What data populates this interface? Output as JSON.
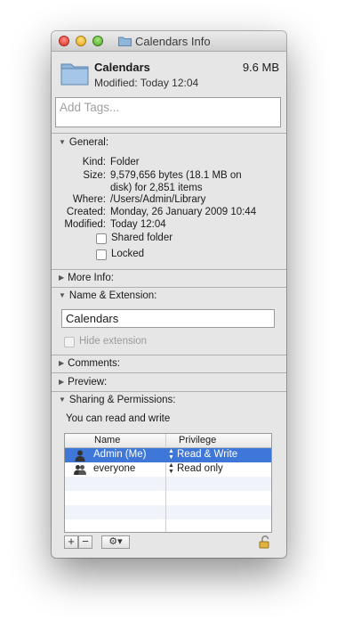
{
  "window": {
    "title": "Calendars Info"
  },
  "header": {
    "name": "Calendars",
    "size": "9.6 MB",
    "modified": "Modified: Today 12:04"
  },
  "tags": {
    "placeholder": "Add Tags..."
  },
  "general": {
    "heading": "General:",
    "kind_label": "Kind:",
    "kind": "Folder",
    "size_label": "Size:",
    "size_line1": "9,579,656 bytes (18.1 MB on",
    "size_line2": "disk) for 2,851 items",
    "where_label": "Where:",
    "where": "/Users/Admin/Library",
    "created_label": "Created:",
    "created": "Monday, 26 January 2009 10:44",
    "modified_label": "Modified:",
    "modified": "Today 12:04",
    "shared_folder": "Shared folder",
    "locked": "Locked"
  },
  "more_info": {
    "heading": "More Info:"
  },
  "name_extension": {
    "heading": "Name & Extension:",
    "value": "Calendars",
    "hide_extension": "Hide extension"
  },
  "comments": {
    "heading": "Comments:"
  },
  "preview": {
    "heading": "Preview:"
  },
  "sharing": {
    "heading": "Sharing & Permissions:",
    "status": "You can read and write",
    "columns": {
      "name": "Name",
      "privilege": "Privilege"
    },
    "rows": [
      {
        "name": "Admin (Me)",
        "privilege": "Read & Write"
      },
      {
        "name": "everyone",
        "privilege": "Read only"
      }
    ]
  },
  "toolbar": {
    "add": "+",
    "remove": "−",
    "action": "⚙▾"
  },
  "colors": {
    "selection": "#3e77d7",
    "folder": "#8fb5da"
  },
  "icons": [
    "folder-icon",
    "disclosure-triangle-icon",
    "user-icon",
    "group-icon",
    "gear-icon",
    "lock-icon"
  ]
}
